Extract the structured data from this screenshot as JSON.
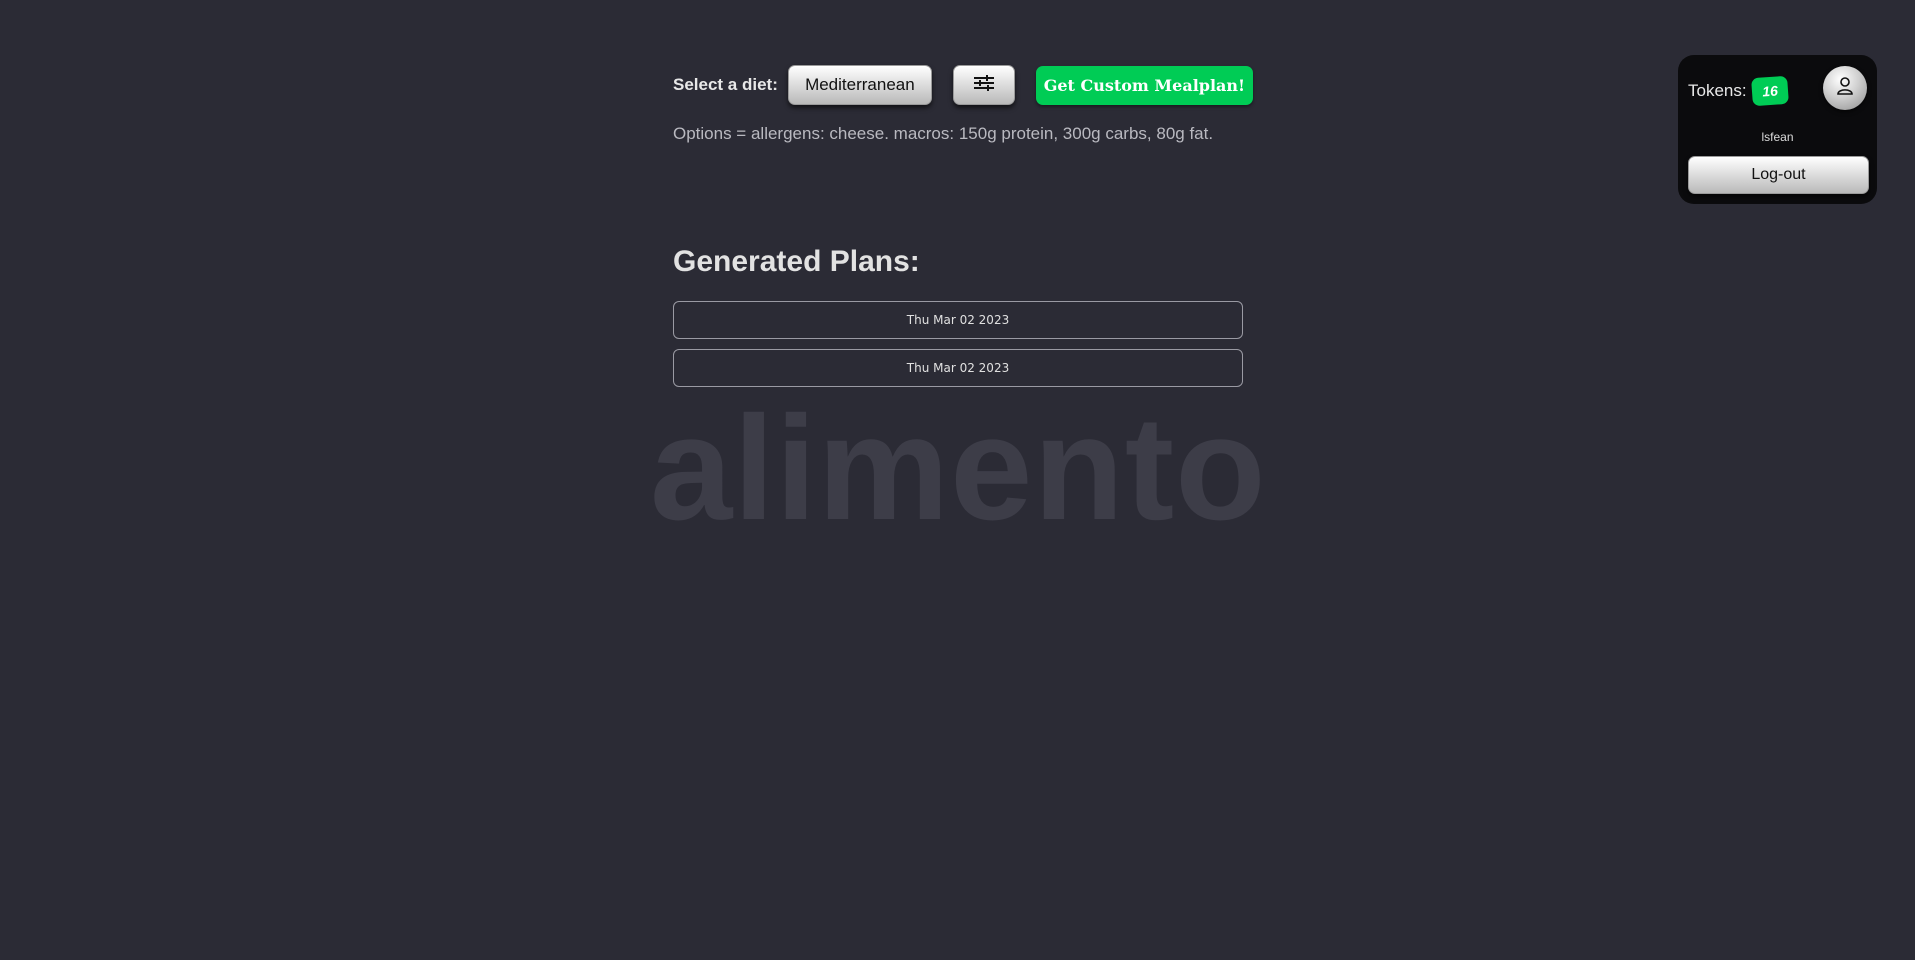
{
  "header": {
    "diet_label": "Select a diet:",
    "diet_selected": "Mediterranean",
    "options_icon": "sliders-icon",
    "mealplan_button": "Get Custom Mealplan!"
  },
  "options_summary": "Options = allergens: cheese. macros: 150g protein, 300g carbs, 80g fat.",
  "plans": {
    "heading": "Generated Plans:",
    "items": [
      {
        "date": "Thu Mar 02 2023"
      },
      {
        "date": "Thu Mar 02 2023"
      }
    ]
  },
  "watermark": "alimento",
  "account": {
    "tokens_label": "Tokens:",
    "tokens_count": "16",
    "avatar_icon": "user-icon",
    "username": "lsfean",
    "logout_label": "Log-out"
  },
  "colors": {
    "background": "#2b2b35",
    "accent_green": "#00cc55",
    "panel": "#0b0b0d"
  }
}
